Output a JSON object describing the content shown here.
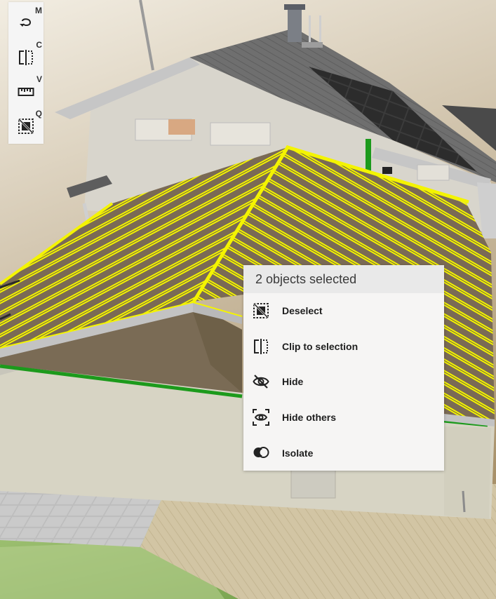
{
  "toolbar": {
    "items": [
      {
        "key": "M",
        "icon": "orbit-icon"
      },
      {
        "key": "C",
        "icon": "clip-icon"
      },
      {
        "key": "V",
        "icon": "measure-ruler-icon"
      },
      {
        "key": "Q",
        "icon": "deselect-icon"
      }
    ]
  },
  "context_menu": {
    "title": "2 objects selected",
    "items": [
      {
        "label": "Deselect",
        "icon": "deselect-icon"
      },
      {
        "label": "Clip to selection",
        "icon": "clip-icon"
      },
      {
        "label": "Hide",
        "icon": "eye-off-icon"
      },
      {
        "label": "Hide others",
        "icon": "eye-focus-icon"
      },
      {
        "label": "Isolate",
        "icon": "isolate-icon"
      }
    ]
  },
  "colors": {
    "selection_highlight": "#f2f200",
    "menu_background": "#f6f5f4",
    "menu_header_background": "#e9e9e9",
    "edge_green": "#1c9a1c"
  }
}
